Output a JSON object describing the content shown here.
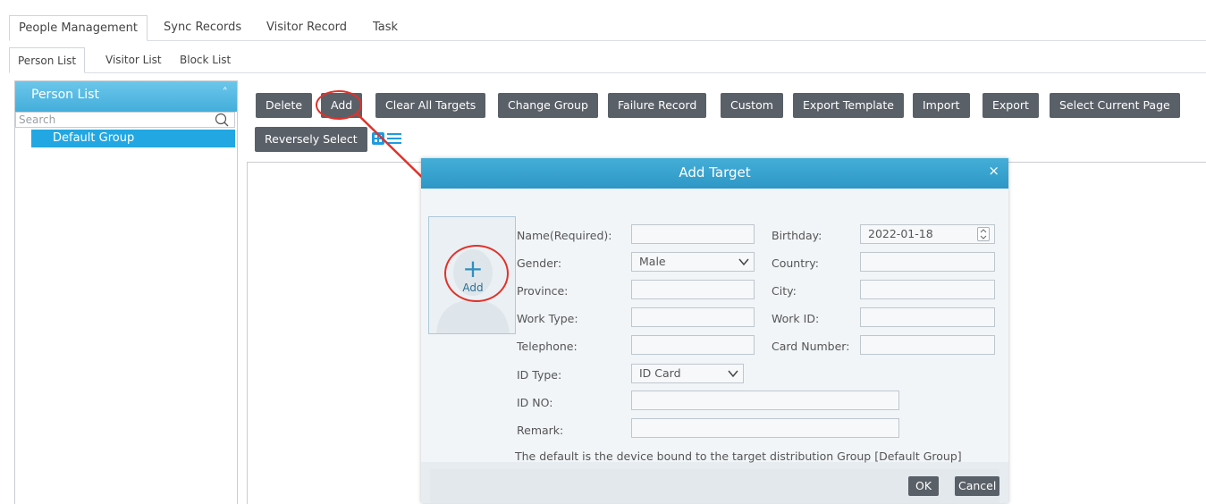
{
  "main_tabs": [
    {
      "label": "People Management",
      "active": true
    },
    {
      "label": "Sync Records",
      "active": false
    },
    {
      "label": "Visitor Record",
      "active": false
    },
    {
      "label": "Task",
      "active": false
    }
  ],
  "sub_tabs": [
    {
      "label": "Person List",
      "active": true
    },
    {
      "label": "Visitor List",
      "active": false
    },
    {
      "label": "Block List",
      "active": false
    }
  ],
  "sidebar": {
    "title": "Person List",
    "collapse_icon": "chevron-up-icon",
    "search_placeholder": "Search",
    "groups": [
      {
        "label": "Default Group",
        "selected": true
      }
    ]
  },
  "toolbar": {
    "buttons": [
      "Delete",
      "Add",
      "Clear All Targets",
      "Change Group",
      "Failure Record",
      "Custom",
      "Export Template",
      "Import",
      "Export",
      "Select Current Page",
      "Reversely Select"
    ],
    "view_icons": [
      "grid-view-icon",
      "list-view-icon"
    ]
  },
  "dialog": {
    "title": "Add Target",
    "close_label": "×",
    "photo_add_symbol": "+",
    "photo_add_label": "Add",
    "labels": {
      "name": "Name(Required):",
      "birthday": "Birthday:",
      "gender": "Gender:",
      "country": "Country:",
      "province": "Province:",
      "city": "City:",
      "work_type": "Work Type:",
      "work_id": "Work ID:",
      "telephone": "Telephone:",
      "card_number": "Card Number:",
      "id_type": "ID Type:",
      "id_no": "ID NO:",
      "remark": "Remark:"
    },
    "values": {
      "name": "",
      "birthday": "2022-01-18",
      "gender": "Male",
      "country": "",
      "province": "",
      "city": "",
      "work_type": "",
      "work_id": "",
      "telephone": "",
      "card_number": "",
      "id_type": "ID Card",
      "id_no": "",
      "remark": ""
    },
    "note": "The default is the device bound to the target distribution Group [Default Group]",
    "ok_label": "OK",
    "cancel_label": "Cancel"
  },
  "colors": {
    "accent": "#22a7e3",
    "header_blue": "#43aedb",
    "button_gray": "#5a6068",
    "annotation_red": "#e0322b"
  }
}
